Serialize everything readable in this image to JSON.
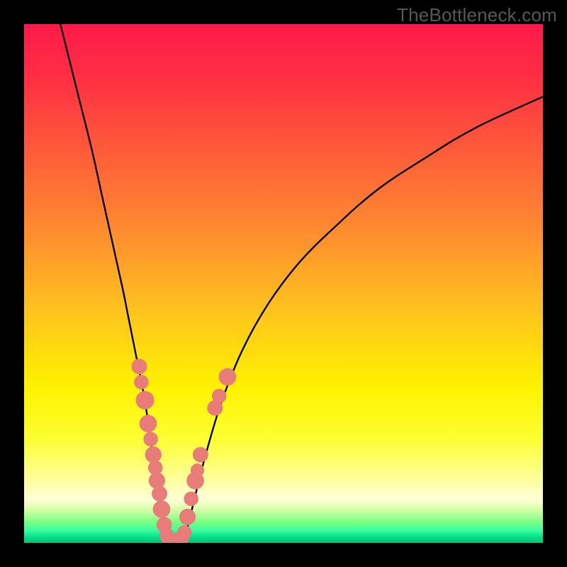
{
  "watermark": "TheBottleneck.com",
  "colors": {
    "frame": "#000000",
    "curve": "#000000",
    "scatter": "#e87c78",
    "gradient_stops": [
      {
        "offset": 0.0,
        "color": "#ff1a49"
      },
      {
        "offset": 0.1,
        "color": "#ff2e44"
      },
      {
        "offset": 0.25,
        "color": "#ff5d39"
      },
      {
        "offset": 0.4,
        "color": "#ff8c2f"
      },
      {
        "offset": 0.55,
        "color": "#ffc21e"
      },
      {
        "offset": 0.7,
        "color": "#fff200"
      },
      {
        "offset": 0.8,
        "color": "#fcff32"
      },
      {
        "offset": 0.88,
        "color": "#ffffa0"
      },
      {
        "offset": 0.915,
        "color": "#ffffd8"
      },
      {
        "offset": 0.93,
        "color": "#e4ffb4"
      },
      {
        "offset": 0.945,
        "color": "#b4ff9a"
      },
      {
        "offset": 0.96,
        "color": "#79ff80"
      },
      {
        "offset": 0.975,
        "color": "#3effa0"
      },
      {
        "offset": 0.99,
        "color": "#00dd8a"
      },
      {
        "offset": 1.0,
        "color": "#00c176"
      }
    ]
  },
  "chart_data": {
    "type": "line",
    "title": "",
    "xlabel": "",
    "ylabel": "",
    "x_range": [
      0,
      100
    ],
    "y_range": [
      0,
      100
    ],
    "note": "Axes and tick labels are hidden in the source image; values below are normalized 0–100 estimates read off pixel positions relative to the plot area.",
    "series": [
      {
        "name": "left-branch",
        "kind": "curve",
        "x": [
          7,
          10,
          13,
          15,
          17,
          19,
          20,
          21,
          22,
          23,
          23.8,
          24.5,
          25.2,
          25.8,
          26.3,
          26.8,
          27.2,
          27.8
        ],
        "y": [
          100,
          88,
          76,
          67,
          58,
          49,
          44,
          39,
          34,
          29,
          24,
          19,
          14,
          10,
          7,
          4,
          2,
          0
        ]
      },
      {
        "name": "right-branch",
        "kind": "curve",
        "x": [
          30.5,
          31.2,
          32,
          33.2,
          35,
          38,
          42,
          47,
          53,
          60,
          68,
          77,
          87,
          100
        ],
        "y": [
          0,
          2,
          5,
          10,
          17,
          27,
          37,
          46,
          54,
          61,
          68,
          74,
          80,
          86
        ]
      },
      {
        "name": "valley-floor",
        "kind": "curve",
        "x": [
          27.8,
          28.4,
          29.0,
          29.6,
          30.1,
          30.5
        ],
        "y": [
          0,
          0,
          0,
          0,
          0,
          0
        ]
      }
    ],
    "scatter": {
      "name": "highlighted-points",
      "points": [
        {
          "x": 22.2,
          "y": 34,
          "r": 1.0
        },
        {
          "x": 22.6,
          "y": 31,
          "r": 0.9
        },
        {
          "x": 23.3,
          "y": 27.5,
          "r": 1.3
        },
        {
          "x": 23.9,
          "y": 23,
          "r": 1.2
        },
        {
          "x": 24.4,
          "y": 20,
          "r": 0.9
        },
        {
          "x": 24.9,
          "y": 17,
          "r": 1.1
        },
        {
          "x": 25.3,
          "y": 14.5,
          "r": 0.9
        },
        {
          "x": 25.6,
          "y": 12,
          "r": 1.1
        },
        {
          "x": 26.1,
          "y": 9.5,
          "r": 1.0
        },
        {
          "x": 26.5,
          "y": 6.5,
          "r": 1.2
        },
        {
          "x": 27.0,
          "y": 3.5,
          "r": 1.0
        },
        {
          "x": 27.5,
          "y": 1.5,
          "r": 0.9
        },
        {
          "x": 28.1,
          "y": 0.5,
          "r": 1.1
        },
        {
          "x": 28.8,
          "y": 0.3,
          "r": 1.0
        },
        {
          "x": 29.5,
          "y": 0.3,
          "r": 1.1
        },
        {
          "x": 30.2,
          "y": 0.5,
          "r": 1.0
        },
        {
          "x": 30.9,
          "y": 2.0,
          "r": 0.9
        },
        {
          "x": 31.5,
          "y": 5.0,
          "r": 1.1
        },
        {
          "x": 32.2,
          "y": 8.5,
          "r": 0.9
        },
        {
          "x": 33.0,
          "y": 12.0,
          "r": 1.2
        },
        {
          "x": 33.4,
          "y": 14.0,
          "r": 0.8
        },
        {
          "x": 34.0,
          "y": 17.0,
          "r": 1.0
        },
        {
          "x": 36.8,
          "y": 26.0,
          "r": 1.0
        },
        {
          "x": 37.6,
          "y": 28.3,
          "r": 0.9
        },
        {
          "x": 39.2,
          "y": 32.0,
          "r": 1.2
        }
      ]
    }
  }
}
